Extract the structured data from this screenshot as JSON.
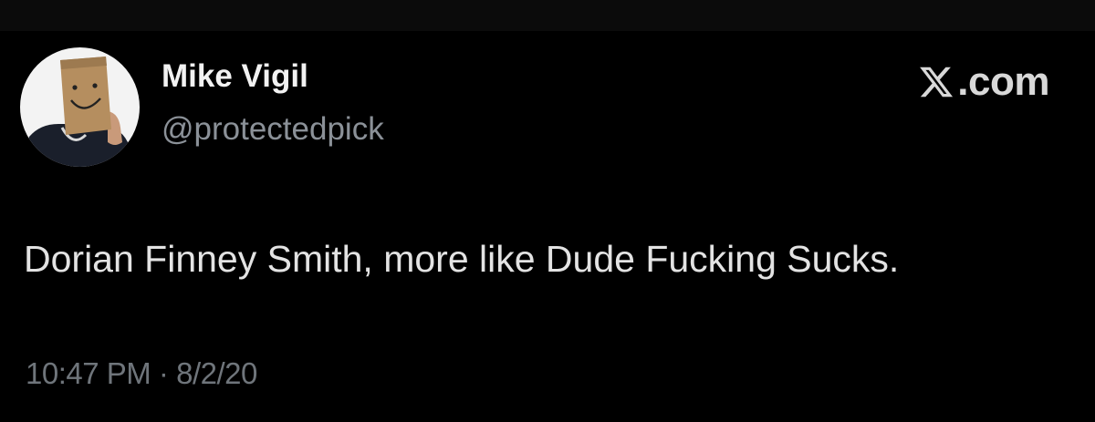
{
  "author": {
    "display_name": "Mike Vigil",
    "handle": "@protectedpick",
    "avatar_icon": "paper-bag-smiley-avatar"
  },
  "brand": {
    "logo_icon": "x-logo-icon",
    "text": ".com"
  },
  "tweet": {
    "text": "Dorian Finney Smith, more like Dude Fucking Sucks.",
    "time": "10:47 PM",
    "separator": "·",
    "date": "8/2/20"
  },
  "colors": {
    "background": "#000000",
    "text_primary": "#e7e9ea",
    "text_secondary": "#8b9198",
    "timestamp": "#6f757b"
  }
}
